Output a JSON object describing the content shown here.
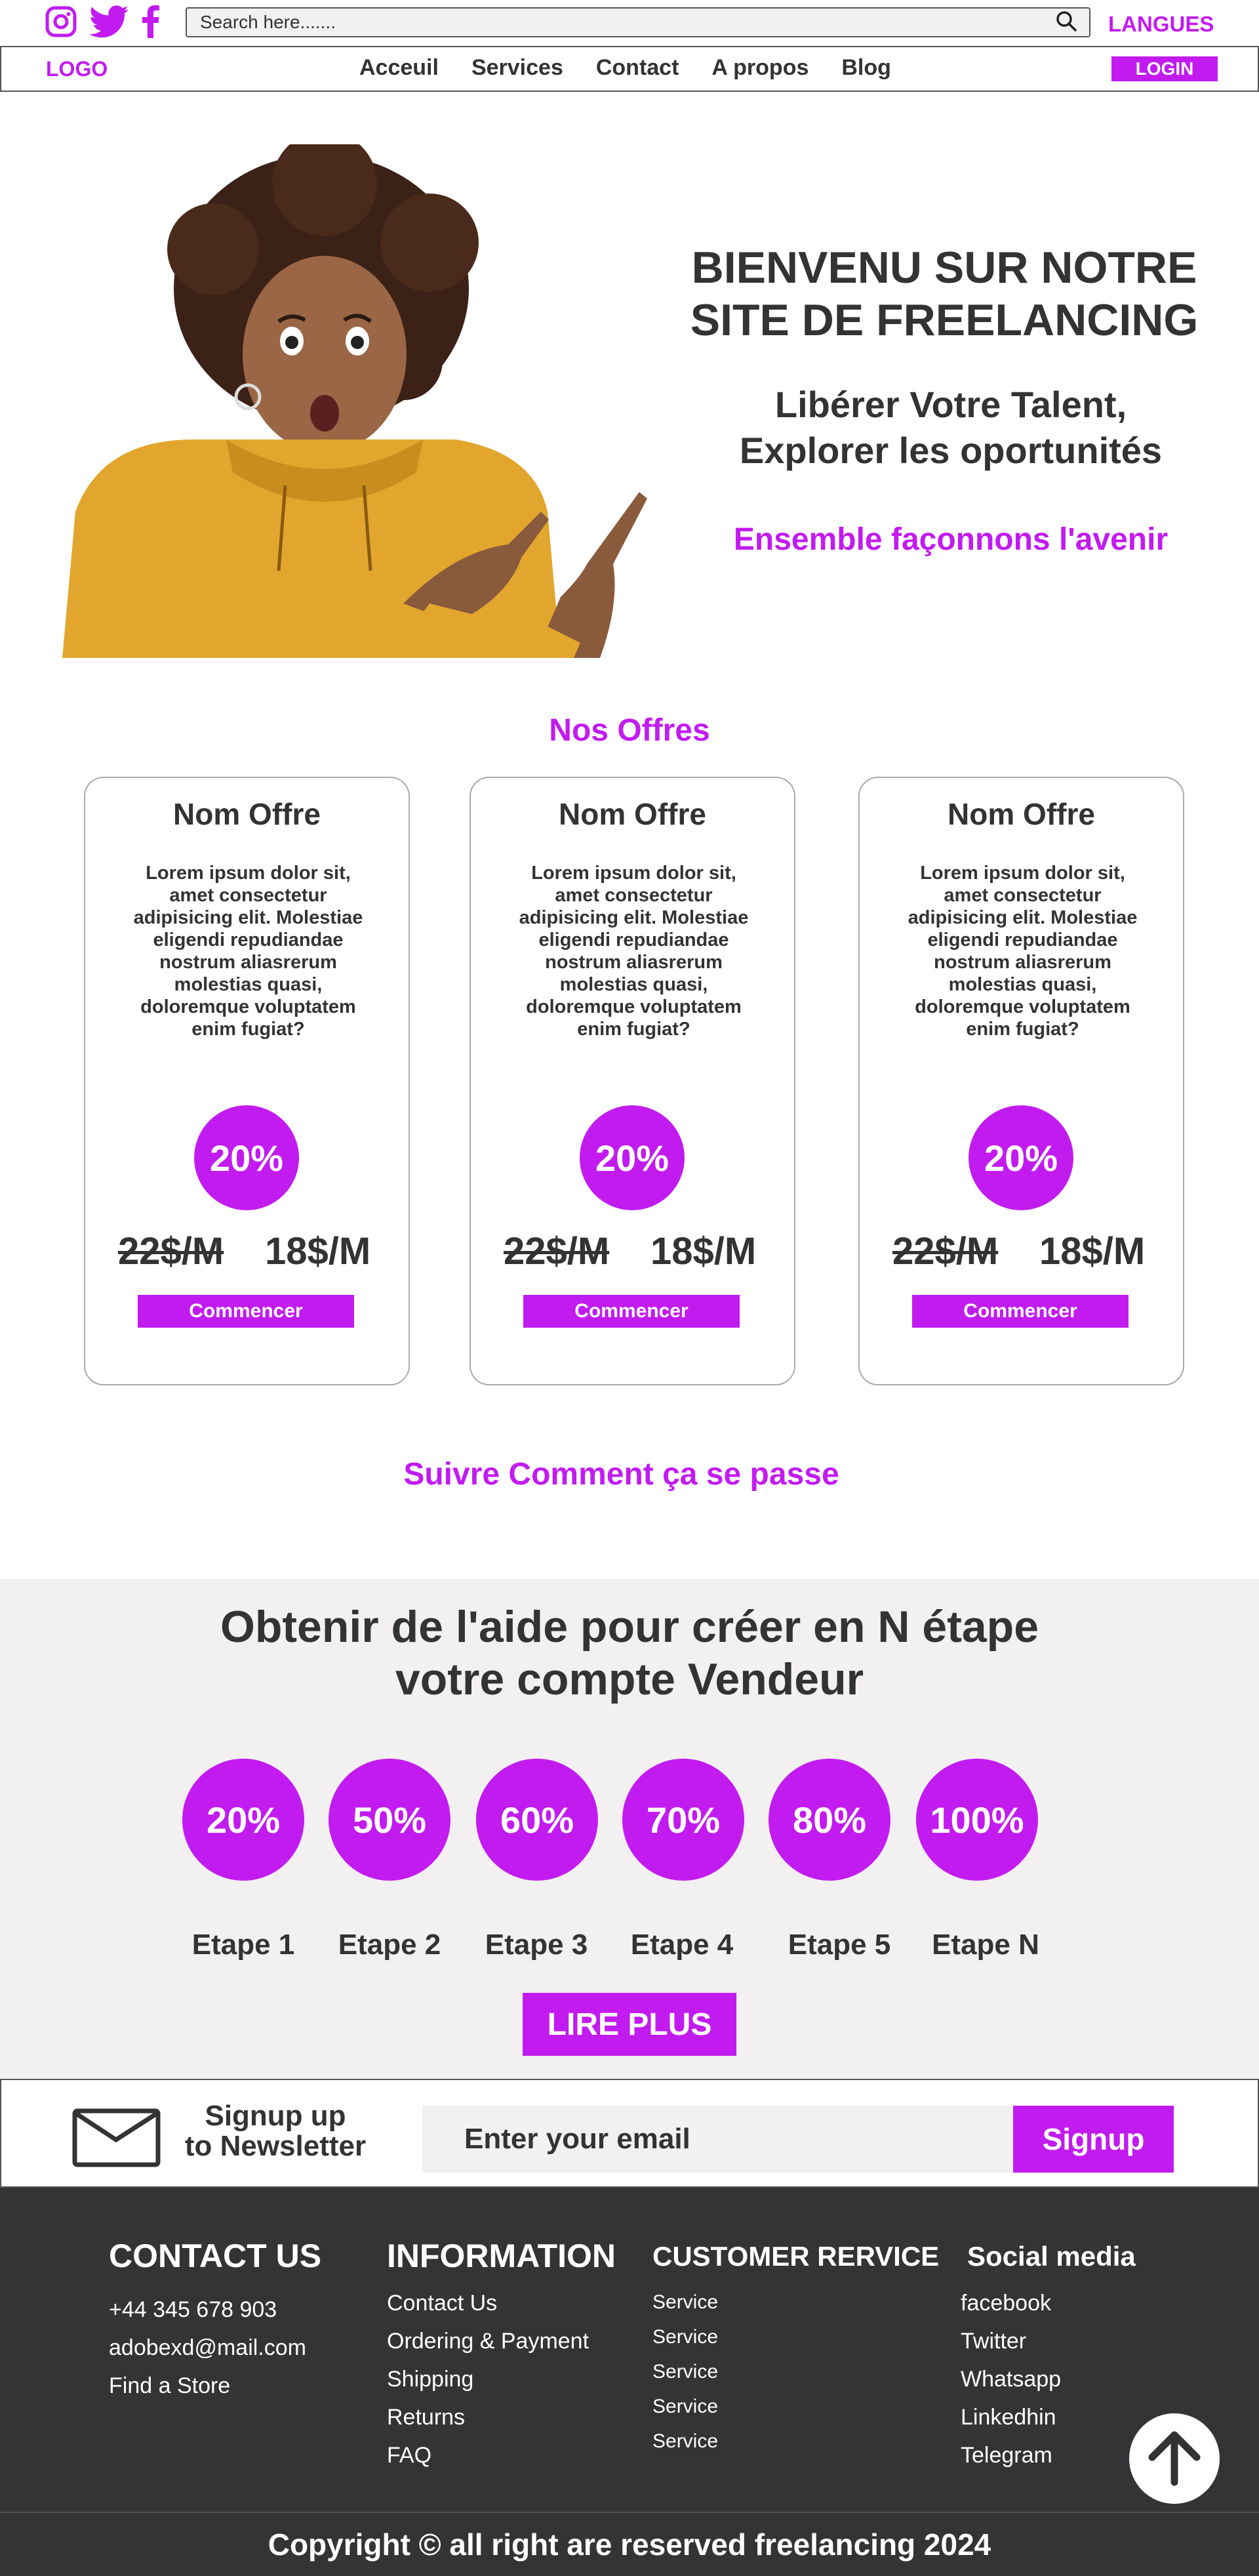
{
  "topbar": {
    "social_icons": [
      "instagram-icon",
      "twitter-icon",
      "facebook-icon"
    ],
    "search_placeholder": "Search here.......",
    "languages_label": "LANGUES"
  },
  "nav": {
    "logo": "LOGO",
    "links": [
      "Acceuil",
      "Services",
      "Contact",
      "A propos",
      "Blog"
    ],
    "login_label": "LOGIN"
  },
  "hero": {
    "title_line1": "BIENVENU SUR NOTRE",
    "title_line2": "SITE DE FREELANCING",
    "subtitle_line1": "Libérer Votre Talent,",
    "subtitle_line2": "Explorer les oportunités",
    "accent": "Ensemble façonnons l'avenir"
  },
  "offers": {
    "section_title": "Nos Offres",
    "cards": [
      {
        "name": "Nom Offre",
        "description": "Lorem ipsum dolor sit, amet consectetur adipisicing elit. Molestiae eligendi repudiandae nostrum aliasrerum molestias quasi, doloremque voluptatem enim fugiat?",
        "discount": "20%",
        "old_price": "22$/M",
        "new_price": "18$/M",
        "button": "Commencer"
      },
      {
        "name": "Nom Offre",
        "description": "Lorem ipsum dolor sit, amet consectetur adipisicing elit. Molestiae eligendi repudiandae nostrum aliasrerum molestias quasi, doloremque voluptatem enim fugiat?",
        "discount": "20%",
        "old_price": "22$/M",
        "new_price": "18$/M",
        "button": "Commencer"
      },
      {
        "name": "Nom Offre",
        "description": "Lorem ipsum dolor sit, amet consectetur adipisicing elit. Molestiae eligendi repudiandae nostrum aliasrerum molestias quasi, doloremque voluptatem enim fugiat?",
        "discount": "20%",
        "old_price": "22$/M",
        "new_price": "18$/M",
        "button": "Commencer"
      }
    ]
  },
  "follow_title": "Suivre Comment ça se passe",
  "steps": {
    "title_line1": "Obtenir de l'aide pour créer  en N étape",
    "title_line2": "votre compte Vendeur",
    "items": [
      {
        "percent": "20%",
        "label": "Etape 1"
      },
      {
        "percent": "50%",
        "label": "Etape 2"
      },
      {
        "percent": "60%",
        "label": "Etape 3"
      },
      {
        "percent": "70%",
        "label": "Etape 4"
      },
      {
        "percent": "80%",
        "label": "Etape 5"
      },
      {
        "percent": "100%",
        "label": "Etape N"
      }
    ],
    "button": "LIRE PLUS"
  },
  "newsletter": {
    "line1": "Signup up",
    "line2": "to Newsletter",
    "placeholder": "Enter your email",
    "button": "Signup"
  },
  "footer": {
    "contact": {
      "heading": "CONTACT US",
      "items": [
        "+44 345 678 903",
        "adobexd@mail.com",
        "Find a Store"
      ]
    },
    "information": {
      "heading": "INFORMATION",
      "items": [
        "Contact Us",
        "Ordering & Payment",
        "Shipping",
        "Returns",
        "FAQ"
      ]
    },
    "customer": {
      "heading": "CUSTOMER RERVICE",
      "items": [
        "Service",
        "Service",
        "Service",
        "Service",
        "Service"
      ]
    },
    "social": {
      "heading": "Social media",
      "items": [
        "facebook",
        "Twitter",
        "Whatsapp",
        "Linkedhin",
        "Telegram"
      ]
    },
    "copyright": "Copyright © all right are reserved freelancing 2024"
  },
  "colors": {
    "accent": "#c21bf0",
    "dark": "#333436",
    "light_bg": "#f2f0f1",
    "text": "#333333"
  }
}
